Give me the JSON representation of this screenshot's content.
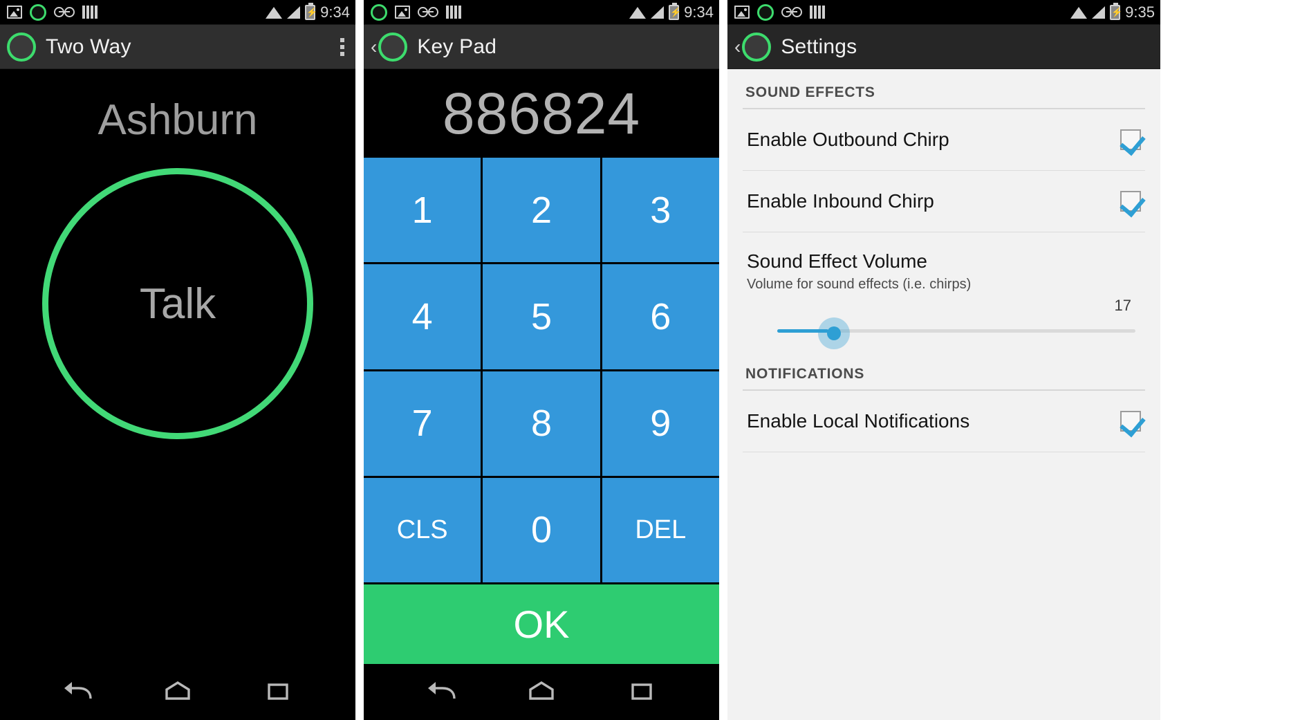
{
  "screens": [
    {
      "id": "two-way",
      "status_bar": {
        "time": "9:34",
        "left_icons": [
          "gallery-icon",
          "green-ring-icon",
          "voicemail-icon",
          "bars-icon"
        ],
        "right_icons": [
          "wifi-icon",
          "signal-icon",
          "battery-charging-icon"
        ]
      },
      "action_bar": {
        "title": "Two Way",
        "logo": "green-ring-logo",
        "overflow": "overflow-menu-icon"
      },
      "content": {
        "city": "Ashburn",
        "talk_label": "Talk",
        "talk_color": "#42d977"
      },
      "nav": [
        "back-icon",
        "home-icon",
        "recents-icon"
      ]
    },
    {
      "id": "key-pad",
      "status_bar": {
        "time": "9:34",
        "left_icons": [
          "green-ring-icon",
          "gallery-icon",
          "voicemail-icon",
          "bars-icon"
        ],
        "right_icons": [
          "wifi-icon",
          "signal-icon",
          "battery-charging-icon"
        ]
      },
      "action_bar": {
        "back": "‹",
        "title": "Key Pad",
        "logo": "green-ring-logo"
      },
      "content": {
        "display": "886824",
        "keys": [
          "1",
          "2",
          "3",
          "4",
          "5",
          "6",
          "7",
          "8",
          "9",
          "CLS",
          "0",
          "DEL"
        ],
        "ok_label": "OK",
        "key_color": "#3498db",
        "ok_color": "#2ecc71"
      },
      "nav": [
        "back-icon",
        "home-icon",
        "recents-icon"
      ]
    },
    {
      "id": "settings",
      "status_bar": {
        "time": "9:35",
        "left_icons": [
          "gallery-icon",
          "green-ring-icon",
          "voicemail-icon",
          "bars-icon"
        ],
        "right_icons": [
          "wifi-icon",
          "signal-icon",
          "battery-charging-icon"
        ]
      },
      "action_bar": {
        "back": "‹",
        "title": "Settings",
        "logo": "green-ring-logo"
      },
      "sections": [
        {
          "header": "SOUND EFFECTS",
          "rows": [
            {
              "type": "checkbox",
              "title": "Enable Outbound Chirp",
              "checked": true
            },
            {
              "type": "checkbox",
              "title": "Enable Inbound Chirp",
              "checked": true
            },
            {
              "type": "slider",
              "title": "Sound Effect Volume",
              "subtitle": "Volume for sound effects (i.e. chirps)",
              "value": "17",
              "accent": "#2e9fd4"
            }
          ]
        },
        {
          "header": "NOTIFICATIONS",
          "rows": [
            {
              "type": "checkbox",
              "title": "Enable Local Notifications",
              "checked": true
            }
          ]
        }
      ]
    }
  ]
}
